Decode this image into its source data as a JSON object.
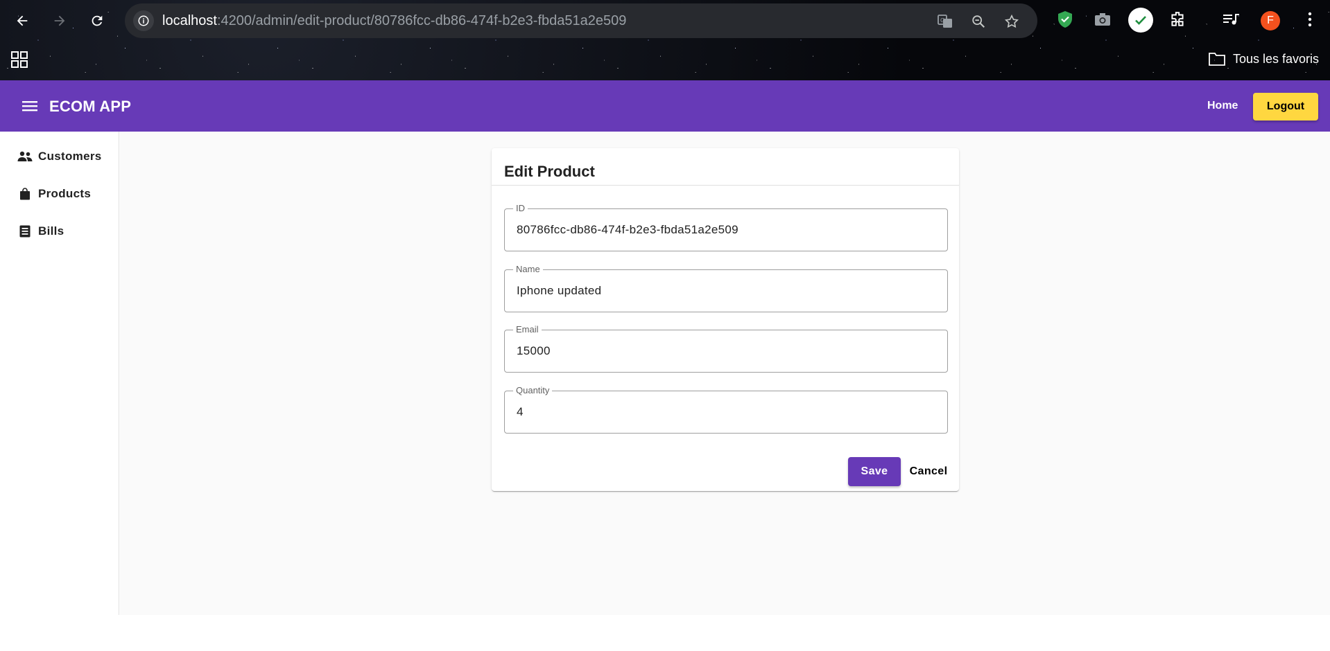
{
  "browser": {
    "url_host": "localhost",
    "url_path": ":4200/admin/edit-product/80786fcc-db86-474f-b2e3-fbda51a2e509",
    "profile_initial": "F",
    "favorites_label": "Tous les favoris"
  },
  "toolbar": {
    "app_title": "ECOM APP",
    "home_label": "Home",
    "logout_label": "Logout",
    "brand_color": "#673ab7",
    "accent_color": "#ffd740"
  },
  "sidebar": {
    "items": [
      {
        "label": "Customers",
        "icon": "people-icon"
      },
      {
        "label": "Products",
        "icon": "shopping-bag-icon"
      },
      {
        "label": "Bills",
        "icon": "receipt-icon"
      }
    ]
  },
  "form": {
    "title": "Edit Product",
    "fields": [
      {
        "label": "ID",
        "value": "80786fcc-db86-474f-b2e3-fbda51a2e509"
      },
      {
        "label": "Name",
        "value": "Iphone updated"
      },
      {
        "label": "Email",
        "value": "15000"
      },
      {
        "label": "Quantity",
        "value": "4"
      }
    ],
    "save_label": "Save",
    "cancel_label": "Cancel"
  }
}
